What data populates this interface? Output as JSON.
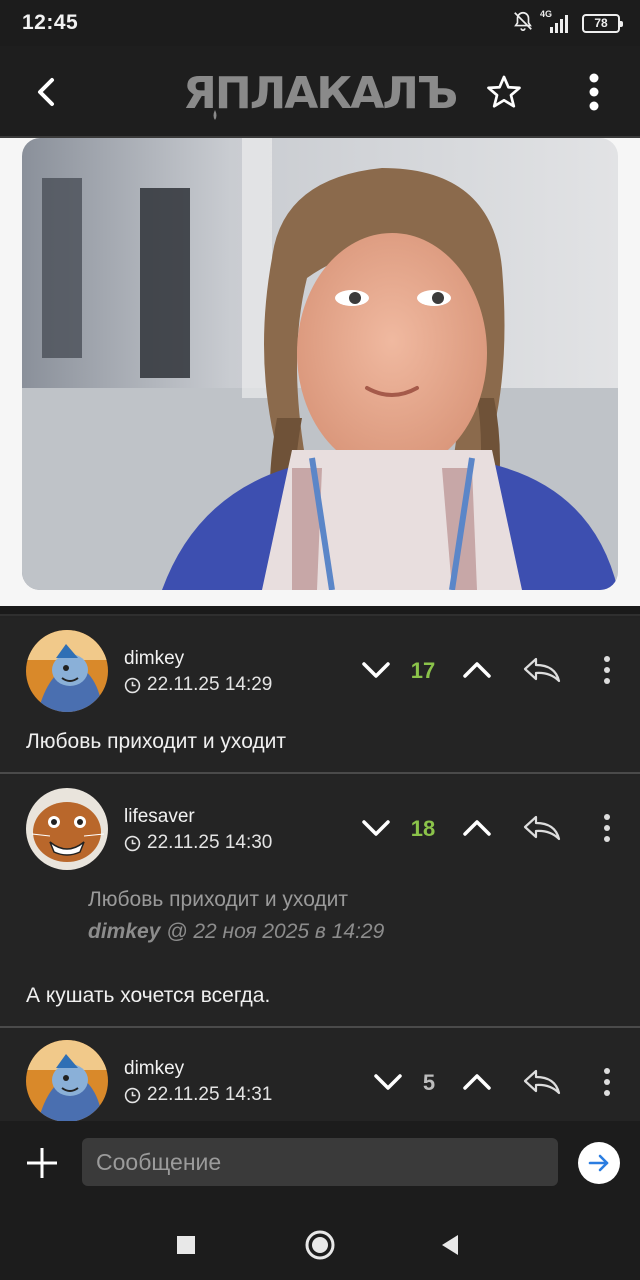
{
  "status_bar": {
    "time": "12:45",
    "network": "4G",
    "battery": "78",
    "icons": [
      "mute-bell-icon",
      "signal-icon",
      "battery-icon"
    ]
  },
  "app_bar": {
    "logo_text": "ЯПЛАКАЛЪ",
    "icons": [
      "back-arrow-icon",
      "star-icon",
      "more-vertical-icon"
    ]
  },
  "post": {
    "image_description_icon": "photo"
  },
  "comments": [
    {
      "username": "dimkey",
      "timestamp": "22.11.25 14:29",
      "score": "17",
      "score_color": "#8bc34a",
      "text": "Любовь приходит и уходит"
    },
    {
      "username": "lifesaver",
      "timestamp": "22.11.25 14:30",
      "score": "18",
      "score_color": "#8bc34a",
      "quote_text": "Любовь приходит и уходит",
      "quote_author": "dimkey",
      "quote_meta": " @ 22 ноя 2025 в 14:29",
      "text": "А кушать хочется всегда."
    },
    {
      "username": "dimkey",
      "timestamp": "22.11.25 14:31",
      "score": "5",
      "score_color": "#bdbdbd"
    }
  ],
  "composer": {
    "placeholder": "Сообщение"
  },
  "colors": {
    "background": "#232323",
    "accent_green": "#8bc34a",
    "send_arrow": "#2a7de1"
  }
}
